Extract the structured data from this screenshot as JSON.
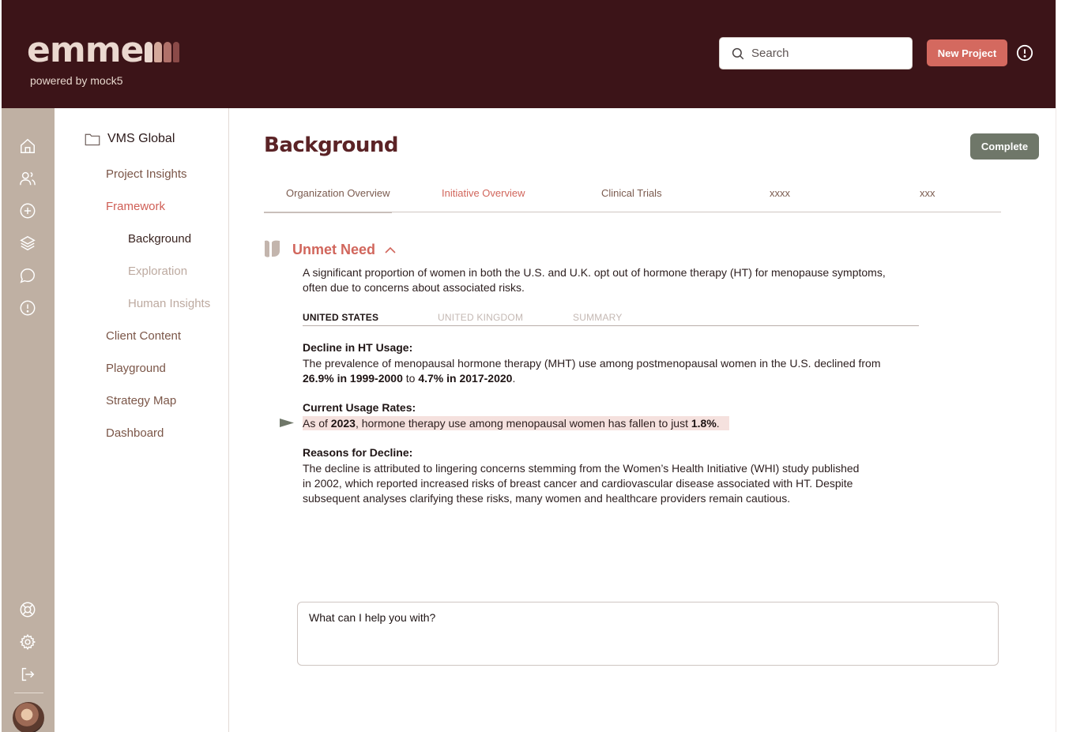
{
  "header": {
    "logo_text": "emme",
    "logo_mark_colors": [
      "#ead8cf",
      "#d4a99b",
      "#b0716a",
      "#8b4a48"
    ],
    "logo_subtitle": "powered by mock5",
    "search_placeholder": "Search",
    "new_project_label": "New Project",
    "info_icon": "alert-circle-icon"
  },
  "rail": {
    "top_icons": [
      "home-icon",
      "users-icon",
      "plus-circle-icon",
      "layers-icon",
      "message-icon",
      "alert-circle-icon"
    ],
    "bottom_icons": [
      "help-lifebuoy-icon",
      "settings-gear-icon",
      "logout-icon"
    ]
  },
  "nav": {
    "project": "VMS Global",
    "items": [
      {
        "label": "Project Insights",
        "state": "normal"
      },
      {
        "label": "Framework",
        "state": "active"
      },
      {
        "label": "Background",
        "state": "current"
      },
      {
        "label": "Exploration",
        "state": "sub"
      },
      {
        "label": "Human Insights",
        "state": "sub"
      },
      {
        "label": "Client Content",
        "state": "normal"
      },
      {
        "label": "Playground",
        "state": "normal"
      },
      {
        "label": "Strategy Map",
        "state": "normal"
      },
      {
        "label": "Dashboard",
        "state": "normal"
      }
    ]
  },
  "main": {
    "title": "Background",
    "complete_label": "Complete",
    "tabs": [
      {
        "label": "Organization Overview",
        "active": false
      },
      {
        "label": "Initiative Overview",
        "active": true
      },
      {
        "label": "Clinical Trials",
        "active": false
      },
      {
        "label": "xxxx",
        "active": false
      },
      {
        "label": "xxx",
        "active": false
      }
    ],
    "section": {
      "title": "Unmet Need",
      "intro_line1": "A significant proportion of women in both the U.S. and U.K. opt out of hormone therapy (HT) for menopause symptoms,",
      "intro_line2": "often due to concerns about associated risks.",
      "subtabs": [
        {
          "label": "UNITED STATES",
          "active": true
        },
        {
          "label": "UNITED KINGDOM",
          "active": false
        },
        {
          "label": "SUMMARY",
          "active": false
        }
      ],
      "decline": {
        "heading": "Decline in HT Usage:",
        "text_before": "The prevalence of menopausal hormone therapy (MHT) use among postmenopausal women in the U.S. declined from",
        "bold1": "26.9% in 1999-2000",
        "mid": "to",
        "bold2": "4.7% in 2017-2020",
        "end": "."
      },
      "current": {
        "heading": "Current Usage Rates:",
        "prefix": "As of ",
        "year": "2023",
        "middle": ", hormone therapy use among menopausal women has fallen to just ",
        "rate": "1.8%",
        "end": "."
      },
      "reasons": {
        "heading": "Reasons for Decline:",
        "line1": "The decline is attributed to lingering concerns stemming from the Women’s Health Initiative (WHI) study published",
        "line2": "in 2002, which reported increased risks of breast cancer and cardiovascular disease associated with HT. Despite",
        "line3": "subsequent analyses clarifying these risks, many women and healthcare providers remain cautious."
      }
    },
    "chat_placeholder": "What can I help you with?"
  },
  "colors": {
    "header_bg": "#3c1418",
    "rail_bg": "#bfb0a3",
    "accent": "#d1665c",
    "complete_bg": "#6f7769",
    "highlight_bg": "#f5e1de"
  }
}
